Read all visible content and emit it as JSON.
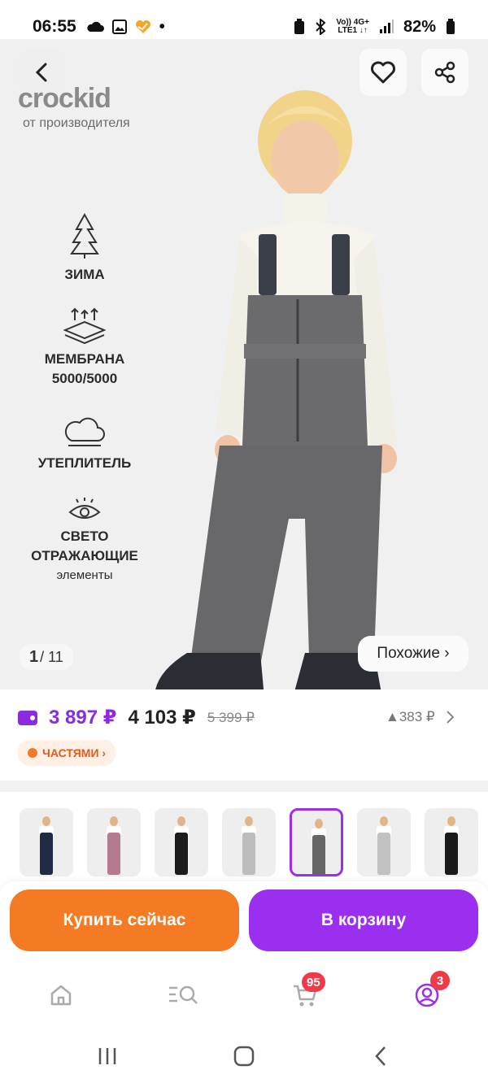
{
  "status_bar": {
    "time": "06:55",
    "battery": "82%",
    "network_top": "Vo)) 4G+",
    "network_bottom": "LTE1 ↓↑",
    "icons": [
      "cloud-icon",
      "image-icon",
      "heart-app-icon",
      "dot-icon",
      "battery-saver-icon",
      "bluetooth-icon",
      "signal-icon",
      "battery-icon"
    ]
  },
  "gallery": {
    "brand_name": "crockid",
    "brand_subtitle": "от производителя",
    "counter_current": "1",
    "counter_total": "/ 11",
    "similar_label": "Похожие ›",
    "features": [
      {
        "label": "ЗИМА",
        "icon": "tree-icon"
      },
      {
        "label": "МЕМБРАНА",
        "label2": "5000/5000",
        "icon": "membrane-icon"
      },
      {
        "label": "УТЕПЛИТЕЛЬ",
        "icon": "cloud-insulation-icon"
      },
      {
        "label": "СВЕТО",
        "label2": "ОТРАЖАЮЩИЕ",
        "label3": "элементы",
        "icon": "eye-icon"
      }
    ]
  },
  "price": {
    "wallet_price": "3 897 ₽",
    "price": "4 103 ₽",
    "old_price": "5 399 ₽",
    "drop": "▲383 ₽",
    "parts_label": "ЧАСТЯМИ ›"
  },
  "thumbnails": {
    "selected_index": 4,
    "colors": [
      "#1f2a44",
      "#b47a8f",
      "#1c1c1c",
      "#bdbdbd",
      "#666666",
      "#c2c2c2",
      "#1a1a1a"
    ]
  },
  "actions": {
    "buy_now": "Купить сейчас",
    "add_to_cart": "В корзину"
  },
  "tabbar": {
    "cart_badge": "95",
    "profile_badge": "3"
  },
  "colors": {
    "accent_purple": "#9a2ff0",
    "accent_orange": "#f57a24"
  }
}
